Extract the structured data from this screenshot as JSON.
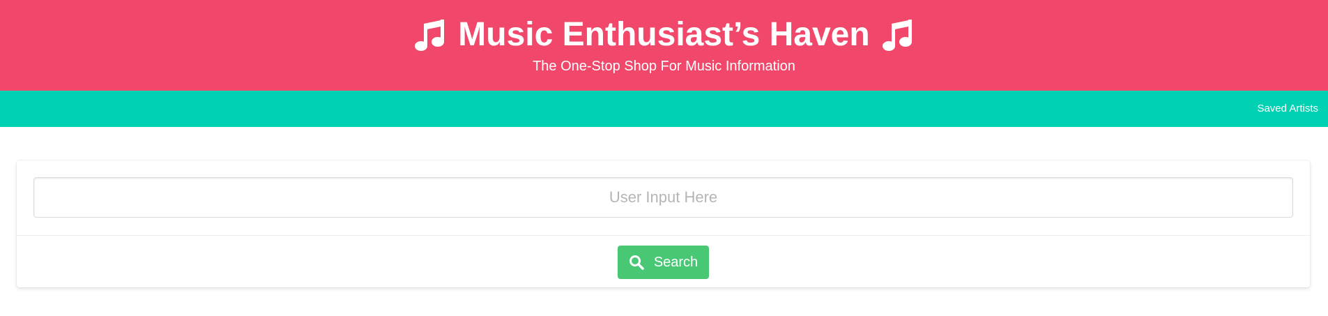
{
  "header": {
    "title": "Music Enthusiast’s Haven",
    "subtitle": "The One-Stop Shop For Music Information",
    "icon": "music-note-icon",
    "background_color": "#f1476a"
  },
  "navbar": {
    "link_label": "Saved Artists",
    "background_color": "#00d1b2"
  },
  "search": {
    "placeholder": "User Input Here",
    "value": "",
    "button_label": "Search",
    "button_icon": "search-icon",
    "button_color": "#48c774"
  }
}
